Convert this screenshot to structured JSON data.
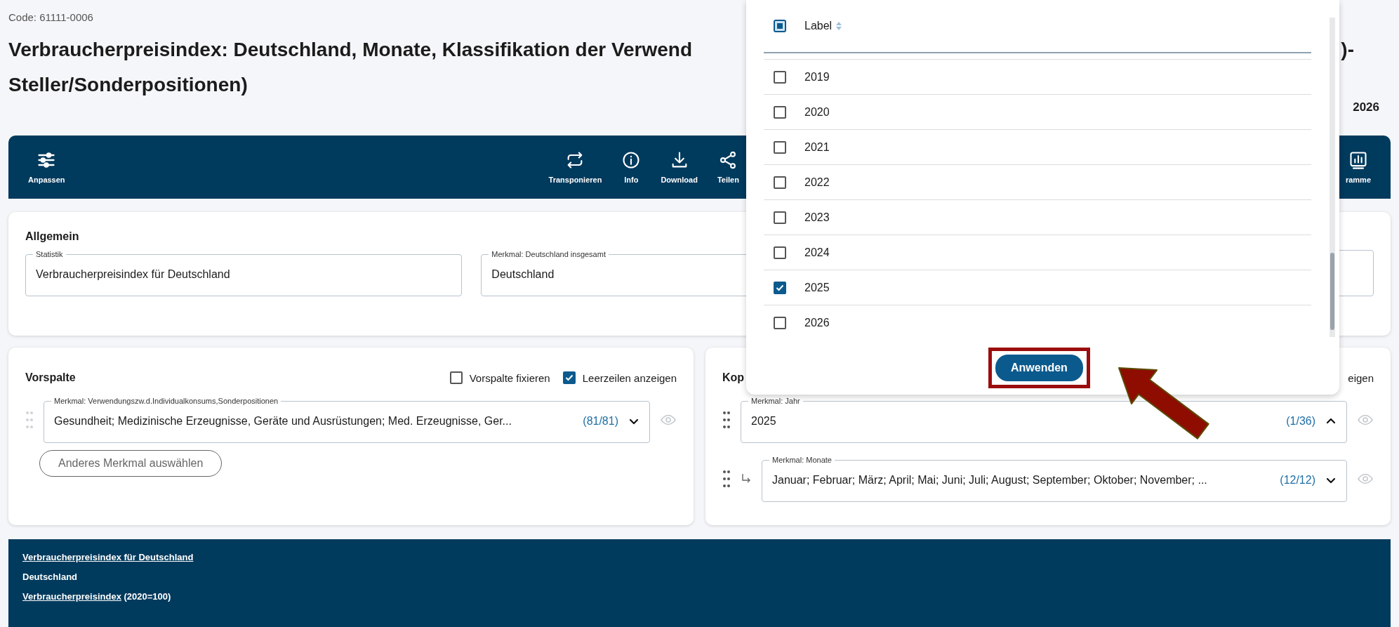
{
  "code": "Code: 61111-0006",
  "title": {
    "line_1": "Verbraucherpreisindex: Deutschland, Monate, Klassifikation der Verwend",
    "line_1_end": ")-",
    "line_2": "Steller/Sonderpositionen)"
  },
  "period": "2026",
  "toolbar": {
    "left": [
      {
        "label": "Anpassen",
        "kind": "sliders"
      }
    ],
    "center": [
      {
        "label": "Transponieren",
        "kind": "swap"
      },
      {
        "label": "Info",
        "kind": "info"
      },
      {
        "label": "Download",
        "kind": "download"
      },
      {
        "label": "Teilen",
        "kind": "share"
      }
    ],
    "right": [
      {
        "label": "ramme",
        "kind": "chart"
      }
    ]
  },
  "general": {
    "heading": "Allgemein",
    "fields": [
      {
        "label": "Statistik",
        "value": "Verbraucherpreisindex für Deutschland"
      },
      {
        "label": "Merkmal: Deutschland insgesamt",
        "value": "Deutschland"
      }
    ]
  },
  "row_header": {
    "heading": "Vorspalte",
    "options": [
      {
        "label": "Vorspalte fixieren",
        "checked": false
      },
      {
        "label": "Leerzeilen anzeigen",
        "checked": true
      }
    ],
    "fields": [
      {
        "label": "Merkmal: Verwendungszw.d.Individualkonsums,Sonderpositionen",
        "value": "Gesundheit; Medizinische Erzeugnisse, Geräte und Ausrüstungen; Med. Erzeugnisse, Ger...",
        "count": "(81/81)",
        "expanded": false,
        "nested": false
      }
    ],
    "button": "Anderes Merkmal auswählen"
  },
  "column_header": {
    "heading": "Kop",
    "option": "eigen",
    "fields": [
      {
        "label": "Merkmal: Jahr",
        "value": "2025",
        "count": "(1/36)",
        "expanded": true,
        "nested": false
      },
      {
        "label": "Merkmal: Monate",
        "value": "Januar; Februar; März; April; Mai; Juni; Juli; August; September; Oktober; November; ...",
        "count": "(12/12)",
        "expanded": false,
        "nested": true
      }
    ]
  },
  "dropdown": {
    "column": "Label",
    "rows": [
      {
        "label": "2019",
        "checked": false
      },
      {
        "label": "2020",
        "checked": false
      },
      {
        "label": "2021",
        "checked": false
      },
      {
        "label": "2022",
        "checked": false
      },
      {
        "label": "2023",
        "checked": false
      },
      {
        "label": "2024",
        "checked": false
      },
      {
        "label": "2025",
        "checked": true
      },
      {
        "label": "2026",
        "checked": false
      }
    ],
    "apply_button": "Anwenden"
  },
  "info": {
    "lines": [
      [
        {
          "text": "Verbraucherpreisindex für Deutschland",
          "link": true
        }
      ],
      [
        {
          "text": "Deutschland",
          "link": false
        }
      ],
      [
        {
          "text": "Verbraucherpreisindex",
          "link": true
        },
        {
          "text": " (2020=100)",
          "link": false
        }
      ]
    ]
  }
}
